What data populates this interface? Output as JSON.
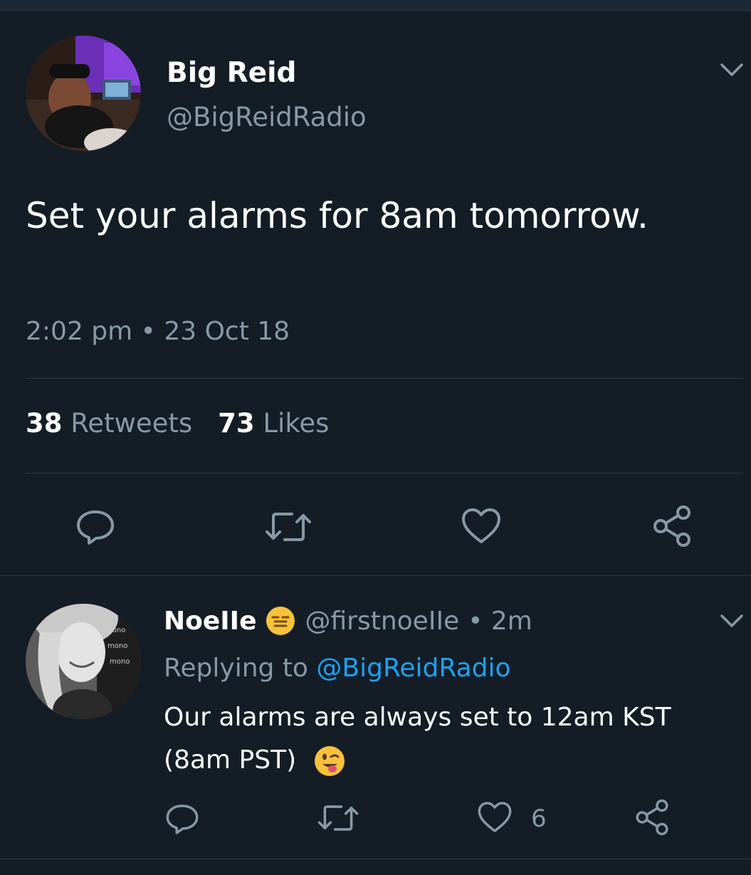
{
  "main_tweet": {
    "author_name": "Big Reid",
    "author_handle": "@BigReidRadio",
    "text": "Set your alarms for 8am tomorrow.",
    "timestamp": "2:02 pm • 23 Oct 18",
    "retweets_count": "38",
    "retweets_label": "Retweets",
    "likes_count": "73",
    "likes_label": "Likes",
    "actions": [
      "reply-icon",
      "retweet-icon",
      "like-icon",
      "share-icon"
    ]
  },
  "reply": {
    "author_name": "NoeIIe",
    "author_emoji": "expressionless-face-emoji",
    "author_handle": "@firstnoeIIe",
    "time_ago": "• 2m",
    "replying_label": "Replying to",
    "replying_to": "@BigReidRadio",
    "text": "Our alarms are always set to 12am KST (8am PST)",
    "text_emoji": "winking-face-with-tongue-emoji",
    "like_count": "6"
  },
  "colors": {
    "background": "#141d26",
    "text": "#ffffff",
    "secondary_text": "#8899a6",
    "link": "#1da1f2",
    "divider": "#2c3a47"
  }
}
